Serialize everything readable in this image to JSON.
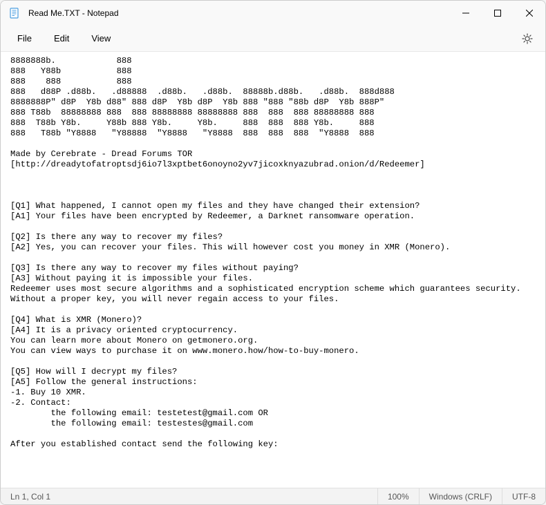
{
  "title": "Read Me.TXT - Notepad",
  "menu": {
    "file": "File",
    "edit": "Edit",
    "view": "View"
  },
  "document_text": "8888888b.            888\n888   Y88b           888\n888    888           888\n888   d88P .d88b.   .d88888  .d88b.   .d88b.  88888b.d88b.   .d88b.  888d888\n8888888P\" d8P  Y8b d88\" 888 d8P  Y8b d8P  Y8b 888 \"888 \"88b d8P  Y8b 888P\"\n888 T88b  88888888 888  888 88888888 88888888 888  888  888 88888888 888\n888  T88b Y8b.     Y88b 888 Y8b.     Y8b.     888  888  888 Y8b.     888\n888   T88b \"Y8888   \"Y88888  \"Y8888   \"Y8888  888  888  888  \"Y8888  888\n\nMade by Cerebrate - Dread Forums TOR\n[http://dreadytofatroptsdj6io7l3xptbet6onoyno2yv7jicoxknyazubrad.onion/d/Redeemer]\n\n\n\n[Q1] What happened, I cannot open my files and they have changed their extension?\n[A1] Your files have been encrypted by Redeemer, a Darknet ransomware operation.\n\n[Q2] Is there any way to recover my files?\n[A2] Yes, you can recover your files. This will however cost you money in XMR (Monero).\n\n[Q3] Is there any way to recover my files without paying?\n[A3] Without paying it is impossible your files.\nRedeemer uses most secure algorithms and a sophisticated encryption scheme which guarantees security.\nWithout a proper key, you will never regain access to your files.\n\n[Q4] What is XMR (Monero)?\n[A4] It is a privacy oriented cryptocurrency.\nYou can learn more about Monero on getmonero.org.\nYou can view ways to purchase it on www.monero.how/how-to-buy-monero.\n\n[Q5] How will I decrypt my files?\n[A5] Follow the general instructions:\n-1. Buy 10 XMR.\n-2. Contact:\n        the following email: testetest@gmail.com OR\n        the following email: testestes@gmail.com\n\nAfter you established contact send the following key:",
  "status": {
    "cursor": "Ln 1, Col 1",
    "zoom": "100%",
    "eol": "Windows (CRLF)",
    "encoding": "UTF-8"
  }
}
